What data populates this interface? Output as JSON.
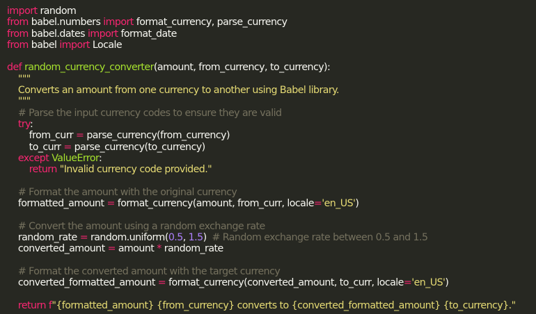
{
  "editor": {
    "lines": [
      [
        {
          "t": "import",
          "c": "kw"
        },
        {
          "t": " random",
          "c": "plain"
        }
      ],
      [
        {
          "t": "from",
          "c": "kw"
        },
        {
          "t": " babel.numbers ",
          "c": "plain"
        },
        {
          "t": "import",
          "c": "kw"
        },
        {
          "t": " format_currency, parse_currency",
          "c": "plain"
        }
      ],
      [
        {
          "t": "from",
          "c": "kw"
        },
        {
          "t": " babel.dates ",
          "c": "plain"
        },
        {
          "t": "import",
          "c": "kw"
        },
        {
          "t": " format_date",
          "c": "plain"
        }
      ],
      [
        {
          "t": "from",
          "c": "kw"
        },
        {
          "t": " babel ",
          "c": "plain"
        },
        {
          "t": "import",
          "c": "kw"
        },
        {
          "t": " Locale",
          "c": "plain"
        }
      ],
      [],
      [
        {
          "t": "def",
          "c": "kw"
        },
        {
          "t": " ",
          "c": "plain"
        },
        {
          "t": "random_currency_converter",
          "c": "fn"
        },
        {
          "t": "(amount, from_currency, to_currency):",
          "c": "plain"
        }
      ],
      [
        {
          "t": "    \"\"\"",
          "c": "str"
        }
      ],
      [
        {
          "t": "    Converts an amount from one currency to another using Babel library.",
          "c": "str"
        }
      ],
      [
        {
          "t": "    \"\"\"",
          "c": "str"
        }
      ],
      [
        {
          "t": "    # Parse the input currency codes to ensure they are valid",
          "c": "cmt"
        }
      ],
      [
        {
          "t": "    ",
          "c": "plain"
        },
        {
          "t": "try",
          "c": "kw"
        },
        {
          "t": ":",
          "c": "plain"
        }
      ],
      [
        {
          "t": "        from_curr ",
          "c": "plain"
        },
        {
          "t": "=",
          "c": "kw"
        },
        {
          "t": " parse_currency(from_currency)",
          "c": "plain"
        }
      ],
      [
        {
          "t": "        to_curr ",
          "c": "plain"
        },
        {
          "t": "=",
          "c": "kw"
        },
        {
          "t": " parse_currency(to_currency)",
          "c": "plain"
        }
      ],
      [
        {
          "t": "    ",
          "c": "plain"
        },
        {
          "t": "except",
          "c": "kw"
        },
        {
          "t": " ",
          "c": "plain"
        },
        {
          "t": "ValueError",
          "c": "cls"
        },
        {
          "t": ":",
          "c": "plain"
        }
      ],
      [
        {
          "t": "        ",
          "c": "plain"
        },
        {
          "t": "return",
          "c": "kw"
        },
        {
          "t": " ",
          "c": "plain"
        },
        {
          "t": "\"Invalid currency code provided.\"",
          "c": "str"
        }
      ],
      [],
      [
        {
          "t": "    # Format the amount with the original currency",
          "c": "cmt"
        }
      ],
      [
        {
          "t": "    formatted_amount ",
          "c": "plain"
        },
        {
          "t": "=",
          "c": "kw"
        },
        {
          "t": " format_currency(amount, from_curr, locale",
          "c": "plain"
        },
        {
          "t": "=",
          "c": "kw"
        },
        {
          "t": "'en_US'",
          "c": "str"
        },
        {
          "t": ")",
          "c": "plain"
        }
      ],
      [],
      [
        {
          "t": "    # Convert the amount using a random exchange rate",
          "c": "cmt"
        }
      ],
      [
        {
          "t": "    random_rate ",
          "c": "plain"
        },
        {
          "t": "=",
          "c": "kw"
        },
        {
          "t": " random.uniform(",
          "c": "plain"
        },
        {
          "t": "0.5",
          "c": "num"
        },
        {
          "t": ", ",
          "c": "plain"
        },
        {
          "t": "1.5",
          "c": "num"
        },
        {
          "t": ")  ",
          "c": "plain"
        },
        {
          "t": "# Random exchange rate between 0.5 and 1.5",
          "c": "cmt"
        }
      ],
      [
        {
          "t": "    converted_amount ",
          "c": "plain"
        },
        {
          "t": "=",
          "c": "kw"
        },
        {
          "t": " amount ",
          "c": "plain"
        },
        {
          "t": "*",
          "c": "kw"
        },
        {
          "t": " random_rate",
          "c": "plain"
        }
      ],
      [],
      [
        {
          "t": "    # Format the converted amount with the target currency",
          "c": "cmt"
        }
      ],
      [
        {
          "t": "    converted_formatted_amount ",
          "c": "plain"
        },
        {
          "t": "=",
          "c": "kw"
        },
        {
          "t": " format_currency(converted_amount, to_curr, locale",
          "c": "plain"
        },
        {
          "t": "=",
          "c": "kw"
        },
        {
          "t": "'en_US'",
          "c": "str"
        },
        {
          "t": ")",
          "c": "plain"
        }
      ],
      [],
      [
        {
          "t": "    ",
          "c": "plain"
        },
        {
          "t": "return",
          "c": "kw"
        },
        {
          "t": " ",
          "c": "plain"
        },
        {
          "t": "f",
          "c": "kw"
        },
        {
          "t": "\"{formatted_amount} {from_currency} converts to {converted_formatted_amount} {to_currency}.\"",
          "c": "str"
        }
      ]
    ]
  },
  "colors": {
    "background": "#272822",
    "keyword": "#f92672",
    "function": "#a6e22e",
    "string": "#e6db74",
    "number": "#ae81ff",
    "comment": "#75715e",
    "text": "#f8f8f2"
  }
}
